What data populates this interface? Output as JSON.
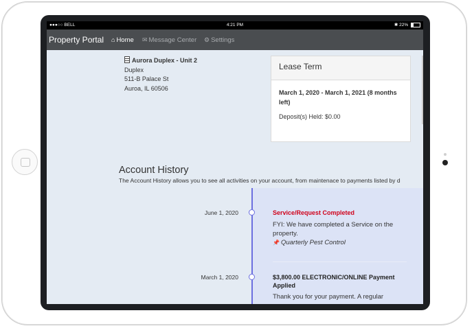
{
  "status_bar": {
    "carrier": "●●●○○ BELL",
    "time": "4:21 PM",
    "battery": "22%",
    "battery_level": 0.22
  },
  "navbar": {
    "brand": "Property Portal",
    "items": [
      {
        "label": "Home",
        "icon": "home-icon",
        "active": true
      },
      {
        "label": "Message Center",
        "icon": "envelope-icon",
        "active": false
      },
      {
        "label": "Settings",
        "icon": "gears-icon",
        "active": false
      }
    ]
  },
  "property": {
    "name": "Aurora Duplex - Unit 2",
    "type": "Duplex",
    "street": "511-B Palace St",
    "city": "Auroa, IL 60506"
  },
  "lease": {
    "heading": "Lease Term",
    "dates": "March 1, 2020 - March 1, 2021 (8 months left)",
    "deposit": "Deposit(s) Held: $0.00"
  },
  "account_history": {
    "title": "Account History",
    "description": "The Account History allows you to see all activities on your account, from maintenace to payments listed by d",
    "events": [
      {
        "date": "June 1, 2020",
        "title": "Service/Request Completed",
        "title_color": "#d0021b",
        "body": "FYI: We have completed a Service on the property.",
        "note": "Quarterly Pest Control"
      },
      {
        "date": "March 1, 2020",
        "title": "$3,800.00 ELECTRONIC/ONLINE Payment Applied",
        "title_color": "#222222",
        "body": "Thank you for your payment. A regular"
      }
    ]
  },
  "colors": {
    "navbar": "#4a4d50",
    "page_bg": "#e4ebf3",
    "timeline": "#6c6fe0",
    "timeline_panel": "#dce3f6"
  }
}
